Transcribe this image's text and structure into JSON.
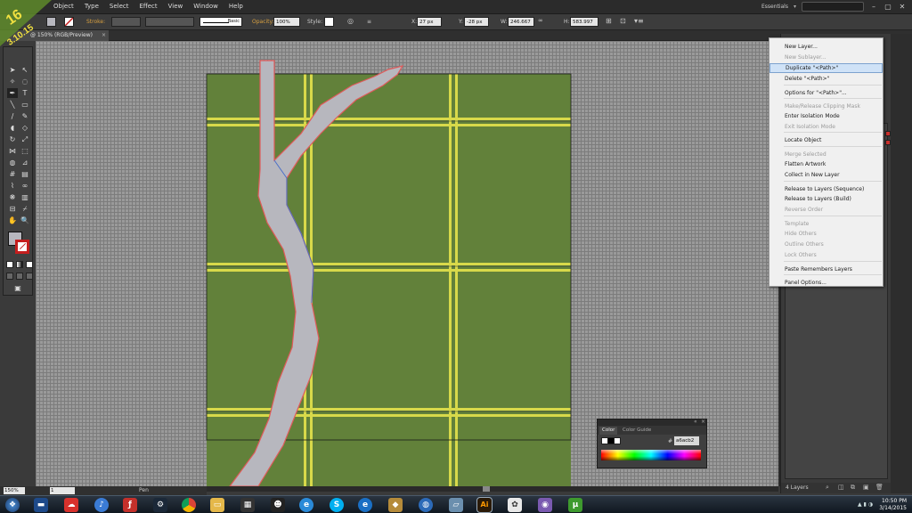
{
  "app": {
    "menus": [
      "Object",
      "Type",
      "Select",
      "Effect",
      "View",
      "Window",
      "Help"
    ],
    "workspace": "Essentials",
    "version_badge": {
      "line1": "16",
      "line2": "3.10.15"
    }
  },
  "controlbar": {
    "stroke_label": "Stroke:",
    "brush": "Basic",
    "opacity_label": "Opacity:",
    "opacity": "100%",
    "style_label": "Style:",
    "x_label": "X:",
    "x": "27 px",
    "y_label": "Y:",
    "y": "-28 px",
    "w_label": "W:",
    "w": "246.667 px",
    "h_label": "H:",
    "h": "583.997 px"
  },
  "document": {
    "tab_title": "@ 150% (RGB/Preview)",
    "close": "×"
  },
  "statusbar": {
    "zoom": "150%",
    "artboard": "1",
    "tool": "Pen"
  },
  "context_menu": {
    "items": [
      {
        "label": "New Layer...",
        "enabled": true
      },
      {
        "label": "New Sublayer...",
        "enabled": false
      },
      {
        "label": "Duplicate \"<Path>\"",
        "enabled": true,
        "highlighted": true
      },
      {
        "label": "Delete \"<Path>\"",
        "enabled": true
      },
      {
        "label": "Options for \"<Path>\"...",
        "enabled": true
      },
      {
        "label": "Make/Release Clipping Mask",
        "enabled": false
      },
      {
        "label": "Enter Isolation Mode",
        "enabled": true
      },
      {
        "label": "Exit Isolation Mode",
        "enabled": false
      },
      {
        "label": "Locate Object",
        "enabled": true
      },
      {
        "label": "Merge Selected",
        "enabled": false
      },
      {
        "label": "Flatten Artwork",
        "enabled": true
      },
      {
        "label": "Collect in New Layer",
        "enabled": true
      },
      {
        "label": "Release to Layers (Sequence)",
        "enabled": true
      },
      {
        "label": "Release to Layers (Build)",
        "enabled": true
      },
      {
        "label": "Reverse Order",
        "enabled": false
      },
      {
        "label": "Template",
        "enabled": false
      },
      {
        "label": "Hide Others",
        "enabled": false
      },
      {
        "label": "Outline Others",
        "enabled": false
      },
      {
        "label": "Lock Others",
        "enabled": false
      },
      {
        "label": "Paste Remembers Layers",
        "enabled": true
      },
      {
        "label": "Panel Options...",
        "enabled": true
      }
    ]
  },
  "layers_panel": {
    "count": "4 Layers"
  },
  "color_panel": {
    "tab_color": "Color",
    "tab_guide": "Color Guide",
    "hex_label": "#",
    "hex": "a6acb2"
  },
  "taskbar": {
    "time": "10:50 PM",
    "date": "3/14/2015",
    "illustrator_label": "Ai"
  },
  "colors": {
    "grass": "#62813a",
    "road": "#b7b7be",
    "yellow_line": "#d8d94a",
    "selection_red": "#e05a5a",
    "selection_blue": "#4a6fc8",
    "accent_orange": "#d8a040"
  }
}
